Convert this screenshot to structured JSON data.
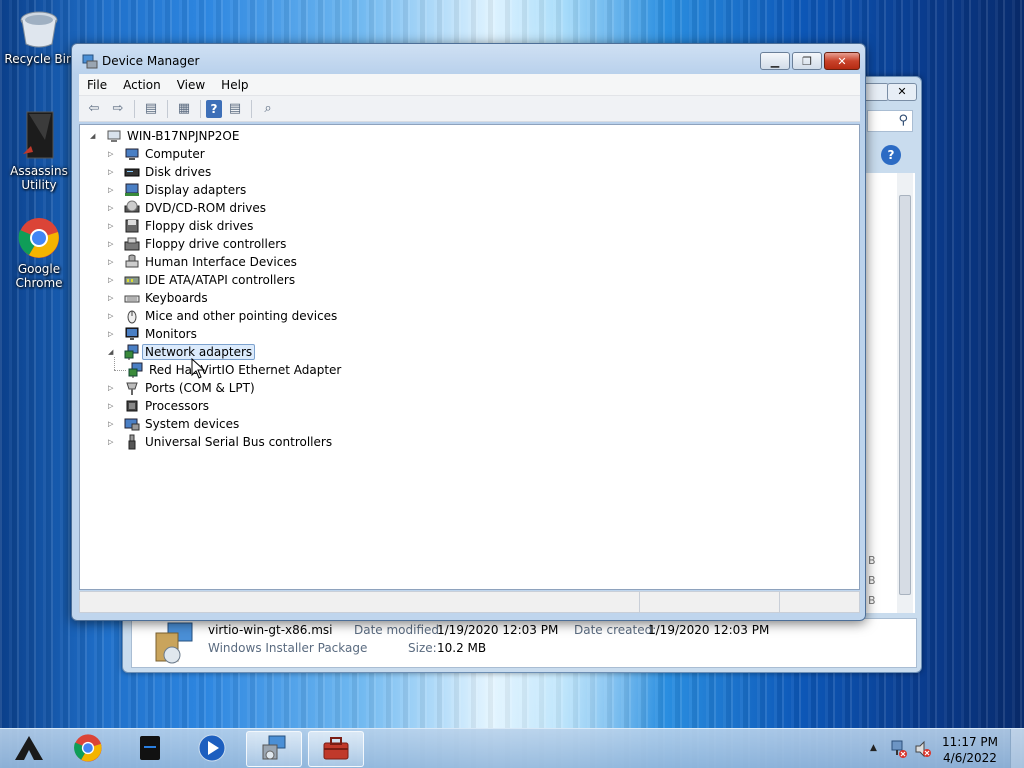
{
  "desktop": {
    "icons": [
      {
        "label": "Recycle Bin"
      },
      {
        "label": "Assassins Utility"
      },
      {
        "label": "Google Chrome"
      }
    ]
  },
  "background_window": {
    "file_name": "virtio-win-gt-x86.msi",
    "date_modified_label": "Date modified:",
    "date_modified": "1/19/2020 12:03 PM",
    "date_created_label": "Date created:",
    "date_created": "1/19/2020 12:03 PM",
    "file_type": "Windows Installer Package",
    "size_label": "Size:",
    "size": "10.2 MB",
    "size_column_fragments": [
      "B",
      "B",
      "B"
    ]
  },
  "device_manager": {
    "title": "Device Manager",
    "menu": [
      "File",
      "Action",
      "View",
      "Help"
    ],
    "root": "WIN-B17NPJNP2OE",
    "categories": [
      {
        "label": "Computer",
        "icon": "computer-icon"
      },
      {
        "label": "Disk drives",
        "icon": "disk-drive-icon"
      },
      {
        "label": "Display adapters",
        "icon": "display-adapter-icon"
      },
      {
        "label": "DVD/CD-ROM drives",
        "icon": "dvd-drive-icon"
      },
      {
        "label": "Floppy disk drives",
        "icon": "floppy-disk-icon"
      },
      {
        "label": "Floppy drive controllers",
        "icon": "floppy-controller-icon"
      },
      {
        "label": "Human Interface Devices",
        "icon": "hid-icon"
      },
      {
        "label": "IDE ATA/ATAPI controllers",
        "icon": "ide-controller-icon"
      },
      {
        "label": "Keyboards",
        "icon": "keyboard-icon"
      },
      {
        "label": "Mice and other pointing devices",
        "icon": "mouse-icon"
      },
      {
        "label": "Monitors",
        "icon": "monitor-icon"
      },
      {
        "label": "Network adapters",
        "icon": "network-adapter-icon",
        "expanded": true,
        "selected": true
      },
      {
        "label": "Red Hat VirtIO Ethernet Adapter",
        "icon": "network-adapter-icon",
        "child": true
      },
      {
        "label": "Ports (COM & LPT)",
        "icon": "port-icon"
      },
      {
        "label": "Processors",
        "icon": "processor-icon"
      },
      {
        "label": "System devices",
        "icon": "system-device-icon"
      },
      {
        "label": "Universal Serial Bus controllers",
        "icon": "usb-icon"
      }
    ]
  },
  "taskbar": {
    "time": "11:17 PM",
    "date": "4/6/2022",
    "apps": [
      "assassins-utility-icon",
      "chrome-icon",
      "drive-icon",
      "media-player-icon",
      "device-manager-icon",
      "toolbox-icon"
    ]
  }
}
